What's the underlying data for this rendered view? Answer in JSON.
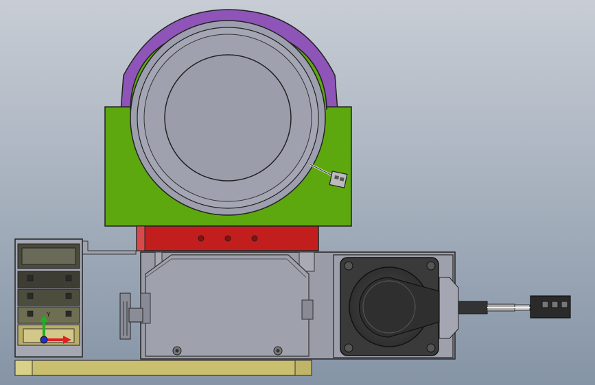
{
  "colors": {
    "background_top": "#c9ced6",
    "background_bottom": "#7f8da1",
    "purple": "#8e54b7",
    "green": "#5ea80f",
    "red": "#c31e1e",
    "gray_body": "#9a9ca8",
    "gray_dark": "#3c3c3c",
    "olive": "#c9bf6e",
    "axis_x": "#e02020",
    "axis_y": "#20b020",
    "axis_z": "#2030d0"
  },
  "icons": {
    "triad": "xyz-axis-triad-icon"
  },
  "triad_label": "Y"
}
